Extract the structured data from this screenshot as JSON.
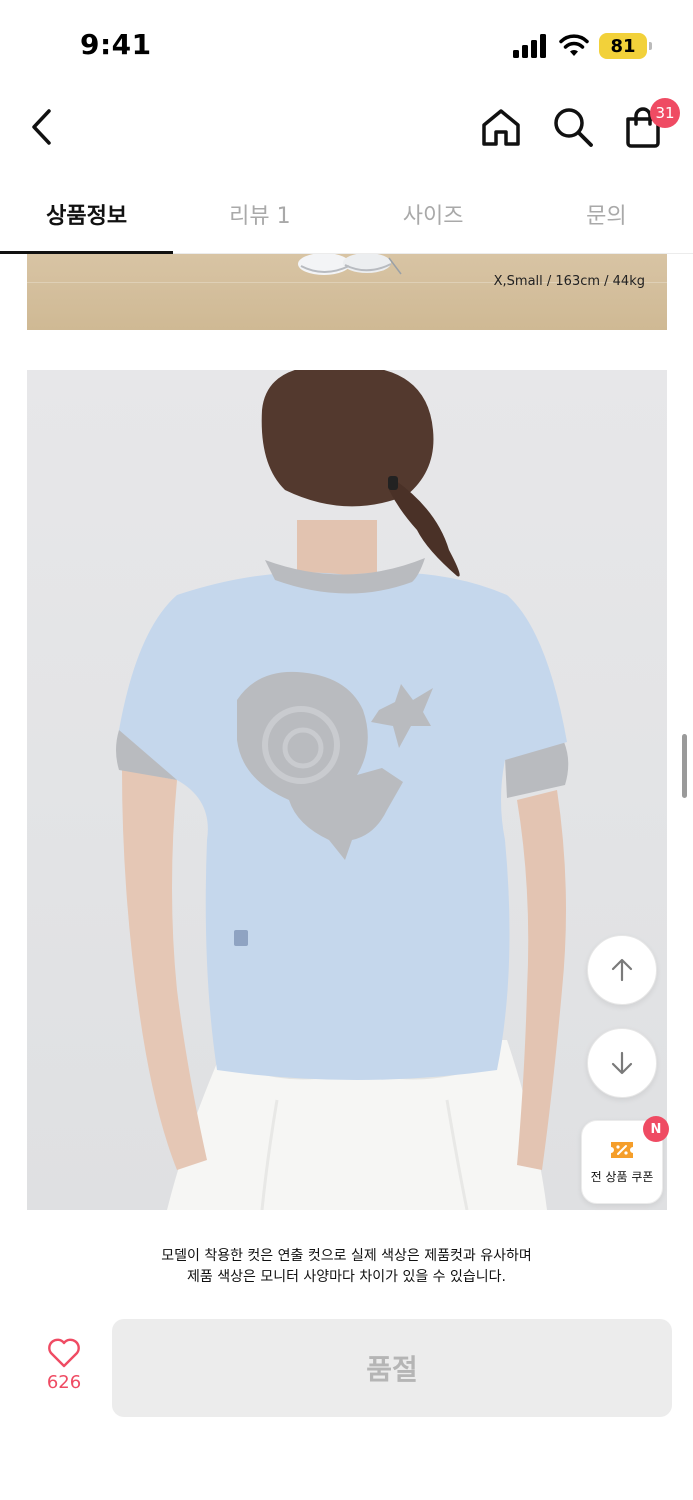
{
  "status_bar": {
    "time": "9:41",
    "battery": "81",
    "icons": [
      "signal-icon",
      "wifi-icon",
      "battery-icon"
    ]
  },
  "header": {
    "icons": [
      "back-arrow-icon",
      "home-icon",
      "search-icon",
      "shopping-bag-icon"
    ],
    "cart_count": "31"
  },
  "tabs": [
    {
      "label": "상품정보",
      "active": true
    },
    {
      "label": "리뷰 1",
      "active": false
    },
    {
      "label": "사이즈",
      "active": false
    },
    {
      "label": "문의",
      "active": false
    }
  ],
  "photos": {
    "top_caption": "X,Small / 163cm / 44kg"
  },
  "notice": {
    "line1": "모델이 착용한 컷은 연출 컷으로 실제 색상은 제품컷과 유사하며",
    "line2": "제품 색상은 모니터 사양마다 차이가 있을 수 있습니다."
  },
  "floating": {
    "coupon_label": "전 상품 쿠폰",
    "new_badge": "N"
  },
  "bottom_bar": {
    "like_count": "626",
    "soldout_label": "품절"
  },
  "colors": {
    "accent": "#ef4b63",
    "shirt": "#c5d7ec",
    "trim": "#b9bbbf",
    "battery": "#f2d13a"
  }
}
